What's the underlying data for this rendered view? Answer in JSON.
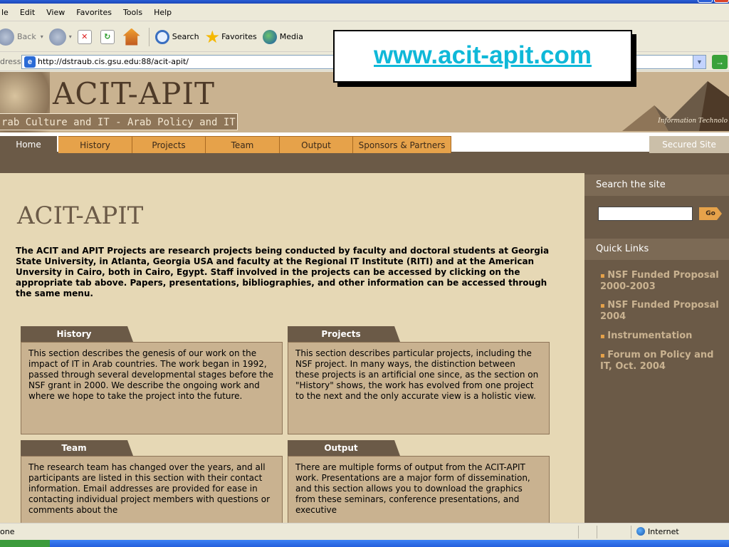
{
  "browser": {
    "menu": [
      "le",
      "Edit",
      "View",
      "Favorites",
      "Tools",
      "Help"
    ],
    "toolbar": {
      "back": "Back",
      "search": "Search",
      "favorites": "Favorites",
      "media": "Media"
    },
    "address_label": "dress",
    "url": "http://dstraub.cis.gsu.edu:88/acit-apit/",
    "status_text": "one",
    "status_zone": "Internet"
  },
  "callout": {
    "text": "www.acit-apit.com"
  },
  "banner": {
    "title": "ACIT-APIT",
    "subtitle": "rab Culture and IT - Arab Policy and IT",
    "tagline": "Information Technolo"
  },
  "nav": {
    "tabs": [
      "Home",
      "History",
      "Projects",
      "Team",
      "Output",
      "Sponsors & Partners"
    ],
    "secured": "Secured Site"
  },
  "main": {
    "heading": "ACIT-APIT",
    "intro": "The ACIT and APIT Projects are research projects being conducted by faculty and doctoral students at Georgia State University, in Atlanta, Georgia USA and faculty at the Regional IT Institute (RITI) and at the American Unversity in Cairo, both in Cairo, Egypt. Staff involved in the projects can be accessed by clicking on the appropriate tab above. Papers, presentations, bibliographies, and other information can be accessed through the same menu.",
    "boxes": [
      {
        "title": "History",
        "text": "This section describes the genesis of our work on the impact of IT in Arab countries. The work began in 1992, passed through several developmental stages before the NSF grant in 2000. We describe the ongoing work and where we hope to take the project into the future."
      },
      {
        "title": "Projects",
        "text": "This section describes particular projects, including the NSF project. In many ways, the distinction between these projects is an artificial one since, as the section on \"History\" shows, the work has evolved from one project to the next and the only accurate view is a holistic view."
      },
      {
        "title": "Team",
        "text": "The research team has changed over the years, and all participants are listed in this section with their contact information. Email addresses are provided for ease in contacting individual project members with questions or comments about the"
      },
      {
        "title": "Output",
        "text": "There are multiple forms of output from the ACIT-APIT work. Presentations are a major form of dissemination, and this section allows you to download the graphics from these seminars, conference presentations, and executive"
      }
    ]
  },
  "sidebar": {
    "search_heading": "Search the site",
    "search_value": "",
    "go_label": "Go",
    "quick_heading": "Quick Links",
    "links": [
      "NSF Funded Proposal 2000-2003",
      "NSF Funded Proposal 2004",
      "Instrumentation",
      "Forum on Policy and IT, Oct. 2004"
    ]
  }
}
